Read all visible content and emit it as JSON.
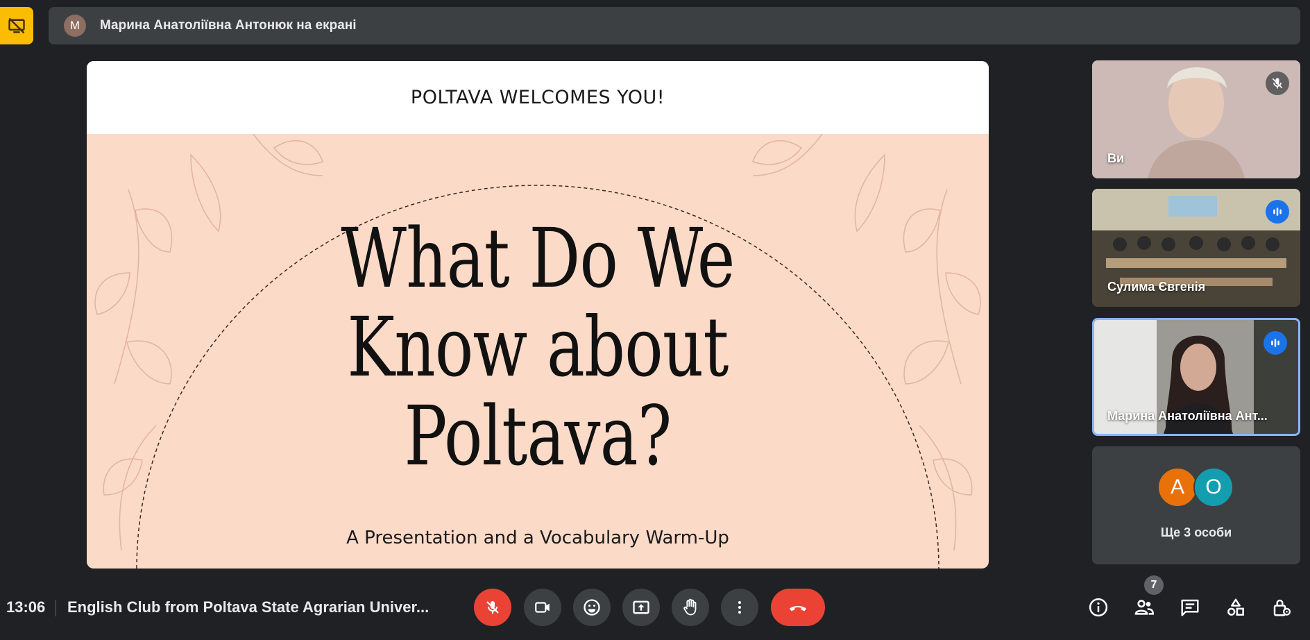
{
  "presenter": {
    "avatar_letter": "М",
    "text": "Марина Анатоліївна Антонюк на екрані"
  },
  "slide": {
    "header": "POLTAVA WELCOMES YOU!",
    "title_lines": [
      "What Do We",
      "Know about",
      "Poltava?"
    ],
    "subtitle": "A Presentation and a Vocabulary Warm-Up"
  },
  "participants": [
    {
      "name": "Ви",
      "mic": "muted"
    },
    {
      "name": "Сулима Євгенія",
      "mic": "speaking"
    },
    {
      "name": "Марина Анатоліївна Ант...",
      "mic": "speaking"
    }
  ],
  "more": {
    "avatars": [
      "А",
      "О"
    ],
    "text": "Ще 3 особи"
  },
  "bottom": {
    "time": "13:06",
    "meeting_title": "English Club from Poltava State Agrarian Univer...",
    "people_count": "7"
  },
  "colors": {
    "background": "#202124",
    "surface": "#3c4043",
    "accent_yellow": "#fbbc04",
    "danger_red": "#ea4335",
    "speaking_blue": "#1a73e8",
    "slide_peach": "#fbdac8"
  },
  "icons": {
    "layout": "present-off-icon",
    "mic": "mic-off-icon",
    "camera": "videocam-icon",
    "emoji": "emoji-icon",
    "present": "present-screen-icon",
    "hand": "raise-hand-icon",
    "more": "more-vert-icon",
    "end": "call-end-icon",
    "info": "info-icon",
    "people": "people-icon",
    "chat": "chat-icon",
    "activities": "activities-icon",
    "host": "host-controls-icon"
  }
}
